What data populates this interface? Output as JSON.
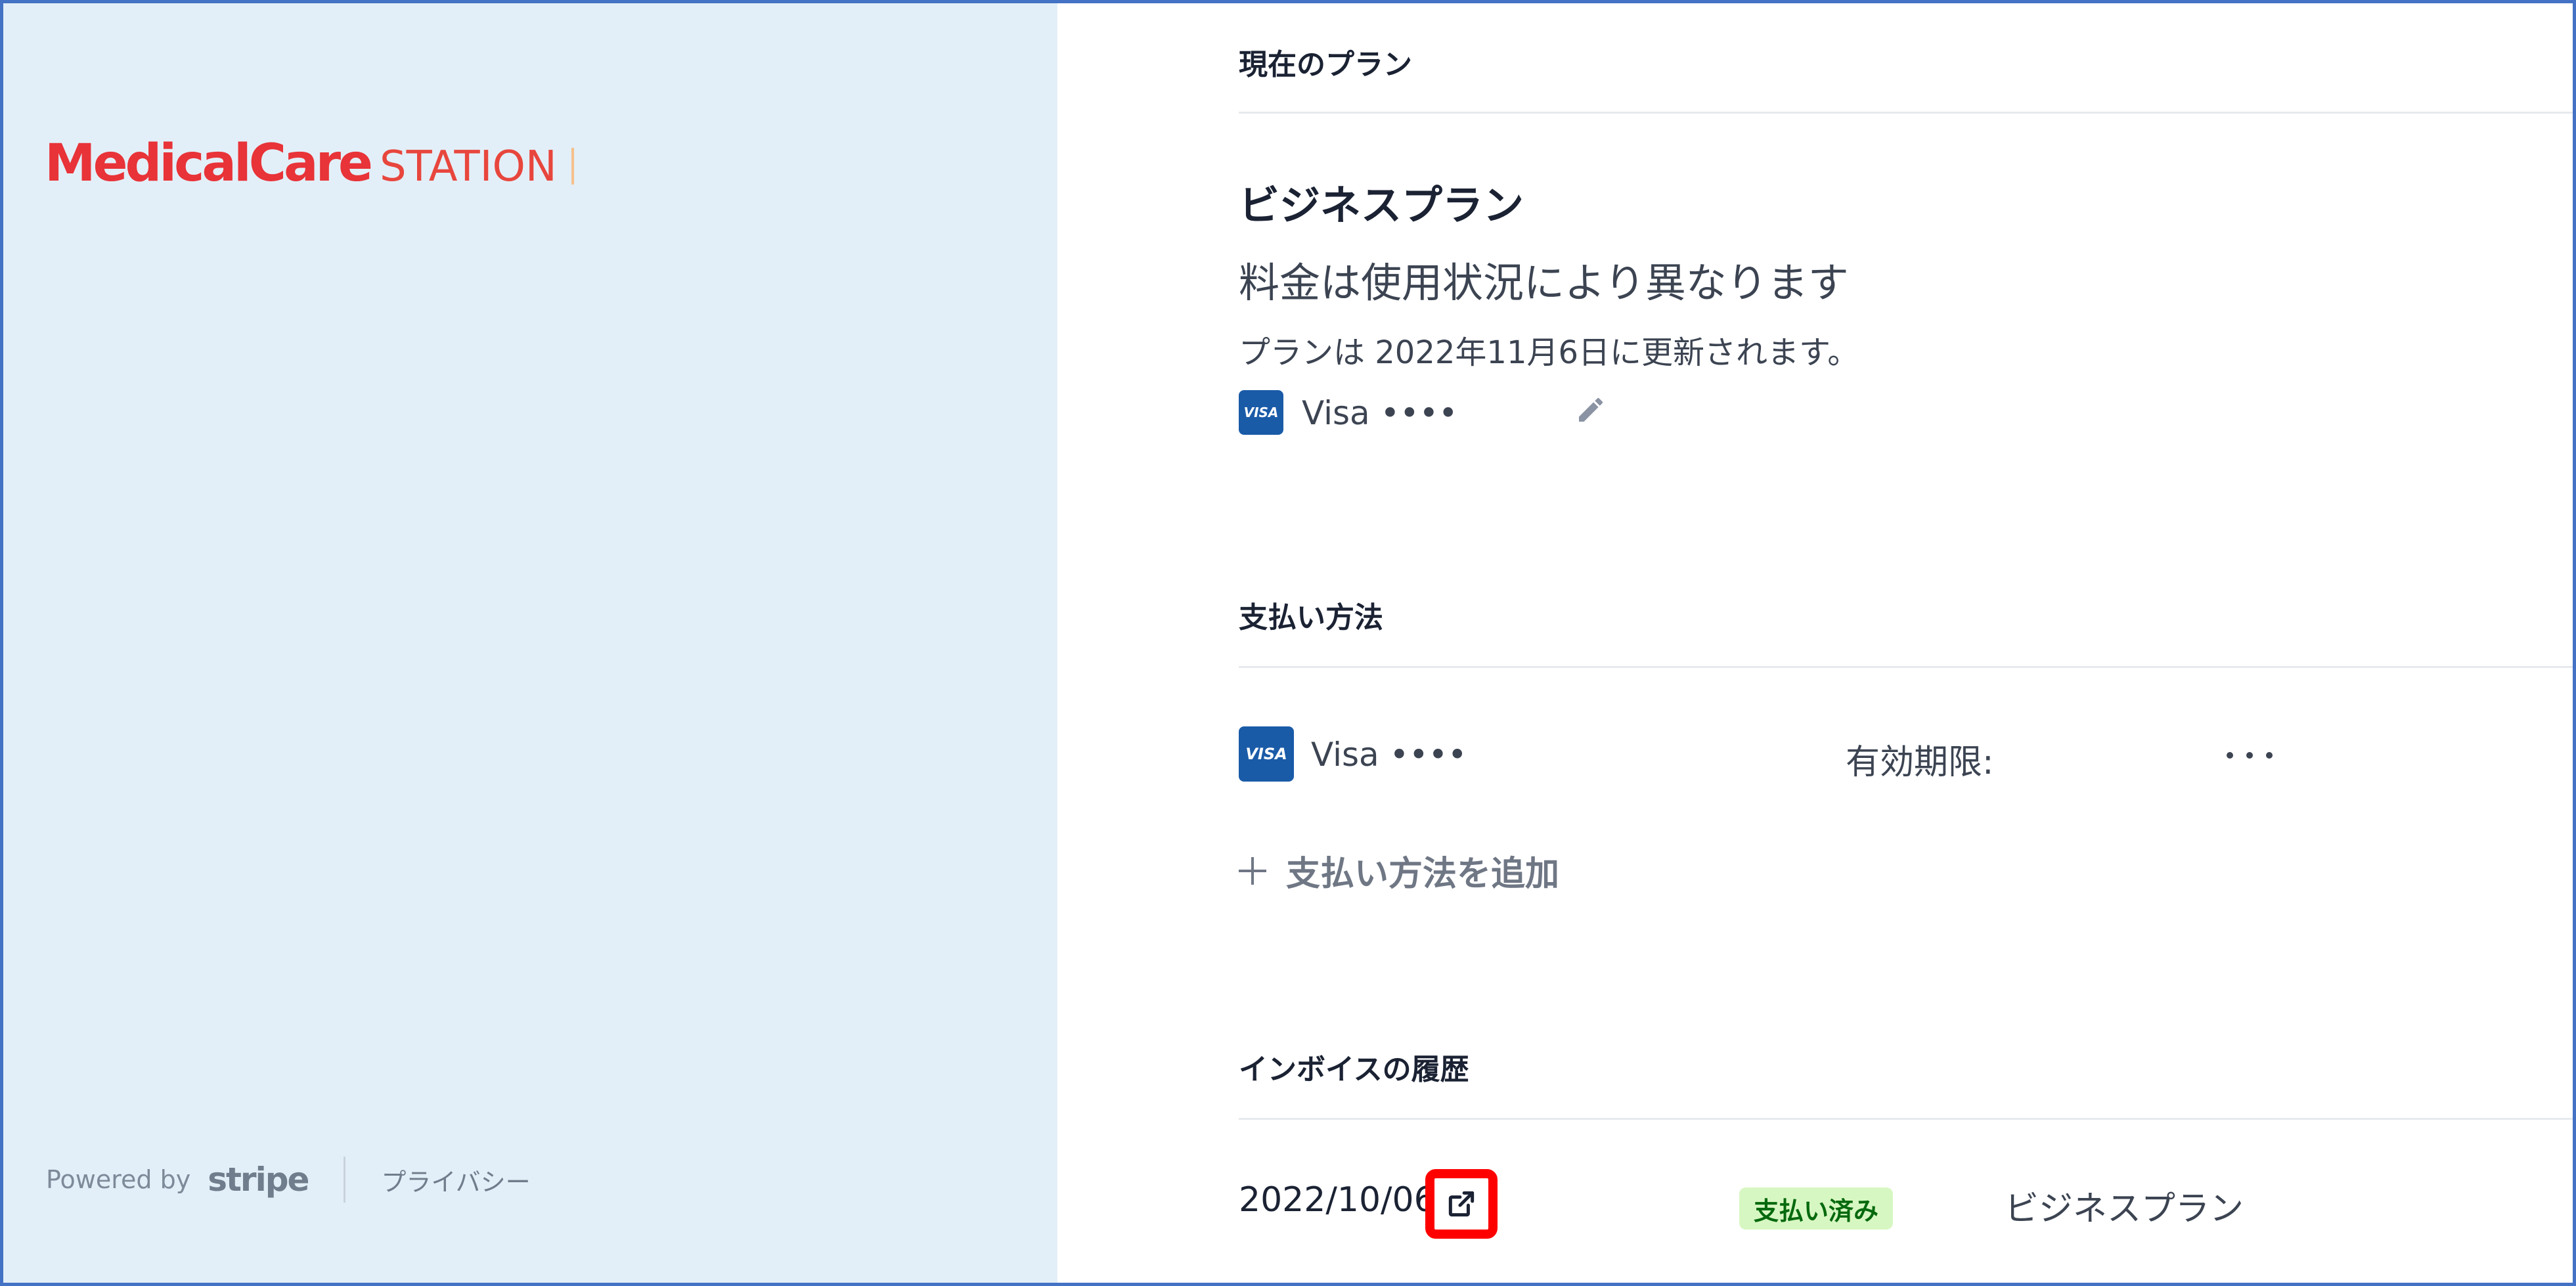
{
  "brand": {
    "logo_main": "MedicalCare",
    "logo_sub": "STATION",
    "brand_color": "#e83338"
  },
  "footer": {
    "powered_by": "Powered by",
    "stripe": "stripe",
    "privacy": "プライバシー"
  },
  "current_plan": {
    "section_title": "現在のプラン",
    "plan_name": "ビジネスプラン",
    "price_text": "料金は使用状況により異なります",
    "renewal_text": "プランは 2022年11月6日に更新されます。",
    "card_brand_badge": "VISA",
    "card_label": "Visa ••••",
    "edit_icon": "pencil-icon"
  },
  "payment_methods": {
    "section_title": "支払い方法",
    "card_brand_badge": "VISA",
    "card_label": "Visa ••••",
    "expiry_label": "有効期限:",
    "more_icon": "ellipsis-icon",
    "add_label": "支払い方法を追加",
    "add_icon": "plus-icon"
  },
  "invoice_history": {
    "section_title": "インボイスの履歴",
    "rows": [
      {
        "date": "2022/10/06",
        "link_icon": "external-link-icon",
        "status": "支払い済み",
        "plan": "ビジネスプラン"
      }
    ]
  },
  "colors": {
    "left_panel_bg": "#e3eff8",
    "visa_blue": "#1a5ba8",
    "paid_badge_bg": "#d7f7c2",
    "paid_badge_text": "#05690d",
    "highlight": "#ff0000"
  }
}
